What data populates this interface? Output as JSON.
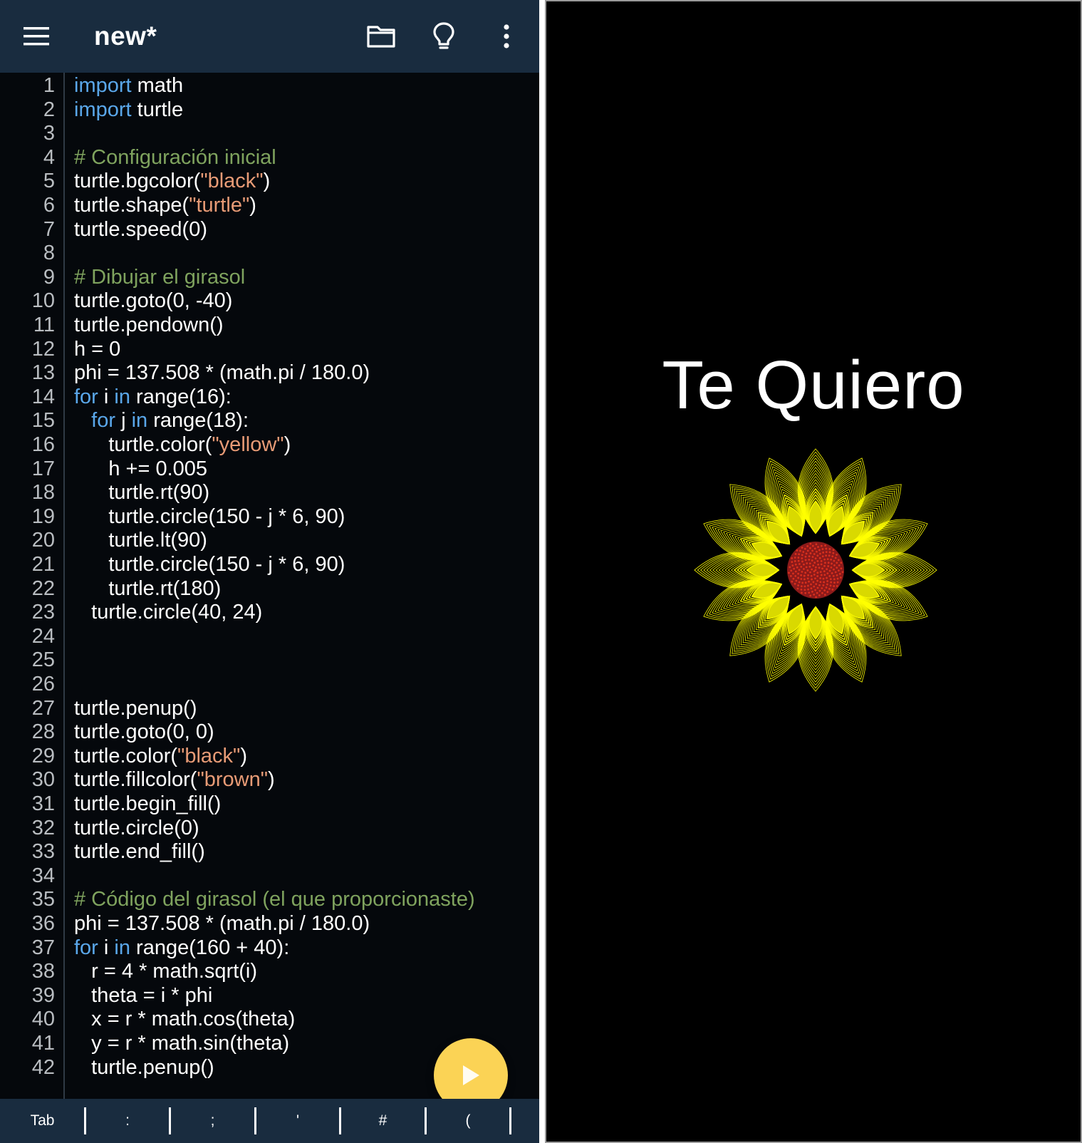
{
  "app_bar": {
    "title": "new*",
    "icons": [
      "menu-icon",
      "folder-icon",
      "lightbulb-icon",
      "more-vert-icon"
    ]
  },
  "code": {
    "lines": [
      [
        {
          "t": "import",
          "c": "kw"
        },
        {
          "t": " math"
        }
      ],
      [
        {
          "t": "import",
          "c": "kw"
        },
        {
          "t": " turtle"
        }
      ],
      [],
      [
        {
          "t": "# Configuración inicial",
          "c": "cmt"
        }
      ],
      [
        {
          "t": "turtle.bgcolor("
        },
        {
          "t": "\"black\"",
          "c": "str"
        },
        {
          "t": ")"
        }
      ],
      [
        {
          "t": "turtle.shape("
        },
        {
          "t": "\"turtle\"",
          "c": "str"
        },
        {
          "t": ")"
        }
      ],
      [
        {
          "t": "turtle.speed(0)"
        }
      ],
      [],
      [
        {
          "t": "# Dibujar el girasol",
          "c": "cmt"
        }
      ],
      [
        {
          "t": "turtle.goto(0, -40)"
        }
      ],
      [
        {
          "t": "turtle.pendown()"
        }
      ],
      [
        {
          "t": "h = 0"
        }
      ],
      [
        {
          "t": "phi = 137.508 * (math.pi / 180.0)"
        }
      ],
      [
        {
          "t": "for",
          "c": "kw"
        },
        {
          "t": " i "
        },
        {
          "t": "in",
          "c": "kw"
        },
        {
          "t": " range(16):"
        }
      ],
      [
        {
          "t": "   "
        },
        {
          "t": "for",
          "c": "kw"
        },
        {
          "t": " j "
        },
        {
          "t": "in",
          "c": "kw"
        },
        {
          "t": " range(18):"
        }
      ],
      [
        {
          "t": "      turtle.color("
        },
        {
          "t": "\"yellow\"",
          "c": "str"
        },
        {
          "t": ")"
        }
      ],
      [
        {
          "t": "      h += 0.005"
        }
      ],
      [
        {
          "t": "      turtle.rt(90)"
        }
      ],
      [
        {
          "t": "      turtle.circle(150 - j * 6, 90)"
        }
      ],
      [
        {
          "t": "      turtle.lt(90)"
        }
      ],
      [
        {
          "t": "      turtle.circle(150 - j * 6, 90)"
        }
      ],
      [
        {
          "t": "      turtle.rt(180)"
        }
      ],
      [
        {
          "t": "   turtle.circle(40, 24)"
        }
      ],
      [],
      [],
      [],
      [
        {
          "t": "turtle.penup()"
        }
      ],
      [
        {
          "t": "turtle.goto(0, 0)"
        }
      ],
      [
        {
          "t": "turtle.color("
        },
        {
          "t": "\"black\"",
          "c": "str"
        },
        {
          "t": ")"
        }
      ],
      [
        {
          "t": "turtle.fillcolor("
        },
        {
          "t": "\"brown\"",
          "c": "str"
        },
        {
          "t": ")"
        }
      ],
      [
        {
          "t": "turtle.begin_fill()"
        }
      ],
      [
        {
          "t": "turtle.circle(0)"
        }
      ],
      [
        {
          "t": "turtle.end_fill()"
        }
      ],
      [],
      [
        {
          "t": "# Código del girasol (el que proporcionaste)",
          "c": "cmt"
        }
      ],
      [
        {
          "t": "phi = 137.508 * (math.pi / 180.0)"
        }
      ],
      [
        {
          "t": "for",
          "c": "kw"
        },
        {
          "t": " i "
        },
        {
          "t": "in",
          "c": "kw"
        },
        {
          "t": " range(160 + 40):"
        }
      ],
      [
        {
          "t": "   r = 4 * math.sqrt(i)"
        }
      ],
      [
        {
          "t": "   theta = i * phi"
        }
      ],
      [
        {
          "t": "   x = r * math.cos(theta)"
        }
      ],
      [
        {
          "t": "   y = r * math.sin(theta)"
        }
      ],
      [
        {
          "t": "   turtle.penup()"
        }
      ]
    ]
  },
  "run_button": {
    "icon": "play-icon"
  },
  "keyboard_bar": {
    "keys": [
      "Tab",
      ":",
      ";",
      "'",
      "#",
      "("
    ]
  },
  "output": {
    "text": "Te Quiero",
    "sunflower": {
      "petal_color": "#ffff00",
      "center_color": "#8b1a1a",
      "background": "#000000",
      "petal_count": 16,
      "loops_per_petal": 18
    }
  },
  "colors": {
    "app_bar": "#192c3f",
    "editor_bg": "#05080c",
    "keyword": "#5aa7ea",
    "string": "#e89b76",
    "comment": "#7fa35e",
    "run_button": "#fbd355"
  }
}
